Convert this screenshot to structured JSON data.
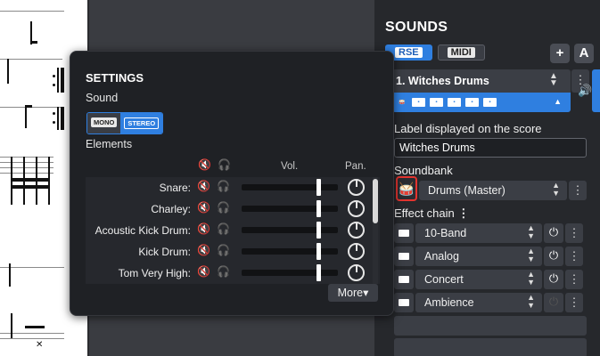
{
  "sounds": {
    "title": "SOUNDS",
    "rse_label": "RSE",
    "midi_label": "MIDI",
    "add_label": "+",
    "a_label": "A",
    "track": {
      "name": "1. Witches Drums"
    },
    "label_heading": "Label displayed on the score",
    "label_value": "Witches Drums",
    "soundbank_heading": "Soundbank",
    "soundbank_value": "Drums (Master)",
    "effect_chain_heading": "Effect chain",
    "effects": [
      "10-Band",
      "Analog",
      "Concert",
      "Ambience"
    ]
  },
  "settings": {
    "title": "SETTINGS",
    "sound_label": "Sound",
    "mono_label": "MONO",
    "stereo_label": "STEREO",
    "elements_label": "Elements",
    "vol_label": "Vol.",
    "pan_label": "Pan.",
    "more_label": "More",
    "rows": [
      {
        "name": "Snare:",
        "volume": 0.78
      },
      {
        "name": "Charley:",
        "volume": 0.78
      },
      {
        "name": "Acoustic Kick Drum:",
        "volume": 0.78
      },
      {
        "name": "Kick Drum:",
        "volume": 0.78
      },
      {
        "name": "Tom Very High:",
        "volume": 0.78
      }
    ]
  },
  "icons": {
    "mute": "speaker-muted-icon",
    "headphones": "headphones-icon",
    "power": "power-icon",
    "kebab": "more-vertical-icon",
    "speaker": "speaker-icon",
    "drum": "drum-icon"
  },
  "colors": {
    "accent": "#2f7fe0",
    "highlight": "#e3342f"
  }
}
